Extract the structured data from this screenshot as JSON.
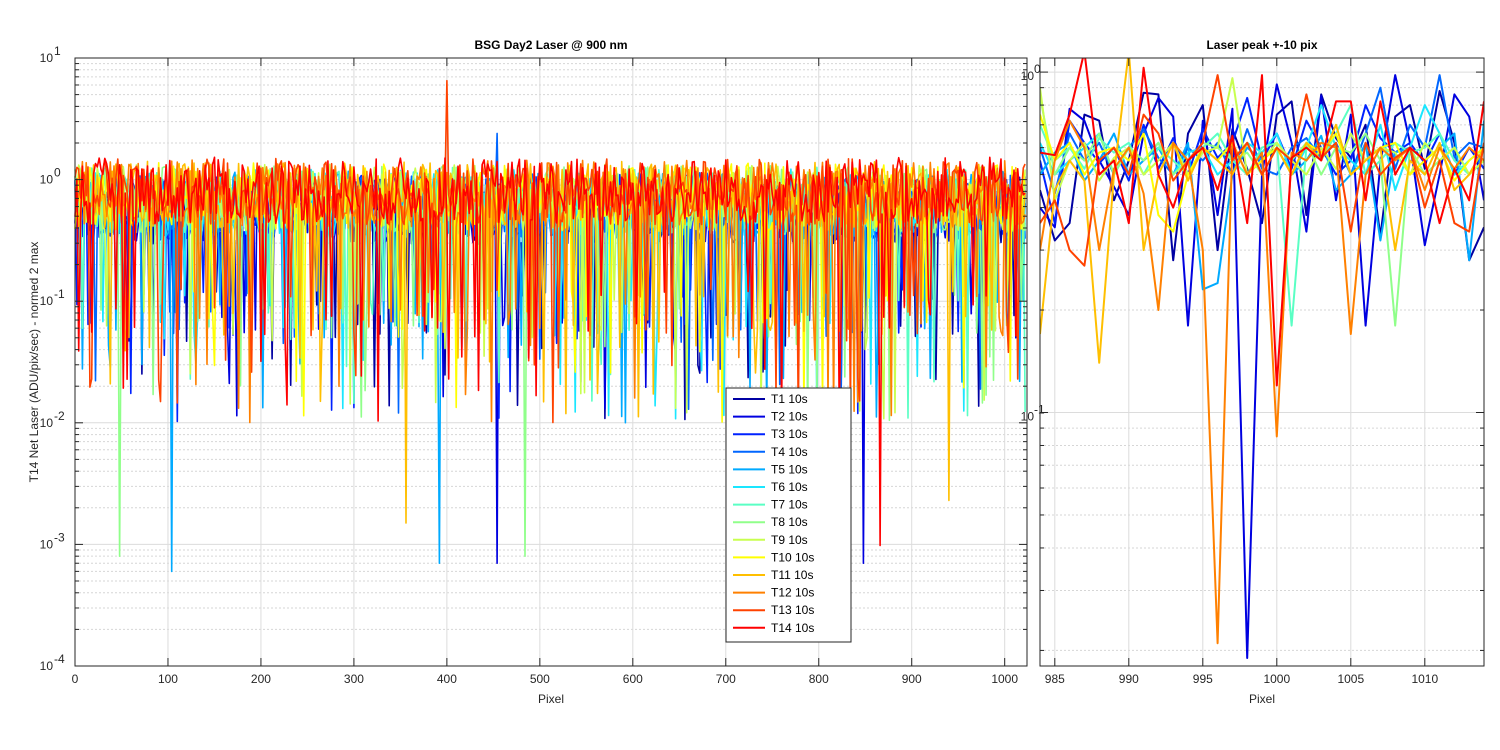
{
  "chart_data": [
    {
      "type": "line",
      "title": "BSG  Day2 Laser @ 900 nm",
      "xlabel": "Pixel",
      "ylabel": "T14 Net Laser (ADU/pix/sec) - normed 2 max",
      "yscale": "log",
      "xlim": [
        0,
        1024
      ],
      "ylim": [
        0.0001,
        10
      ],
      "xticks": [
        "0",
        "100",
        "200",
        "300",
        "400",
        "500",
        "600",
        "700",
        "800",
        "900",
        "1000"
      ],
      "yticks": [
        {
          "base": "10",
          "exp": "-4"
        },
        {
          "base": "10",
          "exp": "-3"
        },
        {
          "base": "10",
          "exp": "-2"
        },
        {
          "base": "10",
          "exp": "-1"
        },
        {
          "base": "10",
          "exp": "0"
        },
        {
          "base": "10",
          "exp": "1"
        }
      ],
      "grid": true,
      "legend_position": "lower-right",
      "series_names": [
        "T1 10s",
        "T2 10s",
        "T3 10s",
        "T4 10s",
        "T5 10s",
        "T6 10s",
        "T7 10s",
        "T8 10s",
        "T9 10s",
        "T10 10s",
        "T11 10s",
        "T12 10s",
        "T13 10s",
        "T14 10s"
      ],
      "series_colors": [
        "#0000a3",
        "#0000e0",
        "#0022ff",
        "#0066ff",
        "#00aaff",
        "#1ae6ff",
        "#5affc4",
        "#90ff8a",
        "#c8ff4f",
        "#ffff00",
        "#ffbf00",
        "#ff8000",
        "#ff4200",
        "#ff0000"
      ],
      "series_summary": "14 normalized laser traces, typical values 0.1-1, occasional dips down to about 6e-4",
      "notable_points": [
        {
          "x": 400,
          "y": 6.5,
          "series": "T13 10s"
        },
        {
          "x": 455,
          "y": 2.4,
          "series": "T4 10s"
        },
        {
          "x": 104,
          "y": 0.0006,
          "series": "T5 10s"
        },
        {
          "x": 454,
          "y": 0.0007,
          "series": "T2 10s"
        },
        {
          "x": 392,
          "y": 0.0007,
          "series": "T5 10s"
        },
        {
          "x": 849,
          "y": 0.0007,
          "series": "T2 10s"
        },
        {
          "x": 866,
          "y": 0.00098,
          "series": "T14 10s"
        },
        {
          "x": 48,
          "y": 0.0008,
          "series": "T8 10s"
        },
        {
          "x": 484,
          "y": 0.0008,
          "series": "T8 10s"
        },
        {
          "x": 357,
          "y": 0.0015,
          "series": "T11 10s"
        },
        {
          "x": 940,
          "y": 0.0023,
          "series": "T11 10s"
        }
      ]
    },
    {
      "type": "line",
      "title": "Laser peak +-10 pix",
      "xlabel": "Pixel",
      "ylabel": "",
      "yscale": "log",
      "xlim": [
        984,
        1014
      ],
      "ylim": [
        0.018,
        1.1
      ],
      "xticks": [
        "985",
        "990",
        "995",
        "1000",
        "1005",
        "1010"
      ],
      "yticks": [
        {
          "base": "10",
          "exp": "-1"
        },
        {
          "base": "10",
          "exp": "0"
        }
      ],
      "grid": true,
      "x": [
        984,
        985,
        986,
        987,
        988,
        989,
        990,
        991,
        992,
        993,
        994,
        995,
        996,
        997,
        998,
        999,
        1000,
        1001,
        1002,
        1003,
        1004,
        1005,
        1006,
        1007,
        1008,
        1009,
        1010,
        1011,
        1012,
        1013,
        1014
      ],
      "series": [
        {
          "name": "T1 10s",
          "values": [
            0.45,
            0.32,
            0.36,
            0.75,
            0.72,
            0.42,
            0.55,
            0.87,
            0.86,
            0.28,
            0.66,
            0.8,
            0.3,
            0.68,
            0.52,
            0.36,
            0.75,
            0.82,
            0.38,
            0.86,
            0.64,
            0.56,
            0.7,
            0.33,
            0.74,
            0.8,
            0.52,
            0.88,
            0.62,
            0.28,
            0.35
          ]
        },
        {
          "name": "T2 10s",
          "values": [
            0.4,
            0.35,
            0.78,
            0.72,
            0.55,
            0.46,
            0.38,
            0.66,
            0.84,
            0.74,
            0.18,
            0.72,
            0.38,
            0.78,
            0.019,
            0.5,
            0.92,
            0.62,
            0.34,
            0.85,
            0.42,
            0.75,
            0.18,
            0.54,
            0.98,
            0.62,
            0.31,
            0.5,
            0.86,
            0.74,
            0.42
          ]
        },
        {
          "name": "T3 10s",
          "values": [
            0.55,
            0.36,
            0.72,
            0.62,
            0.54,
            0.6,
            0.48,
            0.7,
            0.52,
            0.64,
            0.5,
            0.68,
            0.56,
            0.62,
            0.84,
            0.55,
            0.66,
            0.52,
            0.72,
            0.6,
            0.5,
            0.55,
            0.8,
            0.64,
            0.58,
            0.62,
            0.54,
            0.66,
            0.5,
            0.6,
            0.52
          ]
        },
        {
          "name": "T4 10s",
          "values": [
            0.6,
            0.44,
            0.66,
            0.55,
            0.62,
            0.5,
            0.6,
            0.68,
            0.56,
            0.5,
            0.6,
            0.55,
            0.62,
            0.5,
            0.68,
            0.52,
            0.5,
            0.6,
            0.64,
            0.56,
            0.62,
            0.5,
            0.66,
            0.9,
            0.52,
            0.7,
            0.6,
            0.98,
            0.56,
            0.62,
            0.6
          ]
        },
        {
          "name": "T5 10s",
          "values": [
            0.5,
            0.58,
            0.62,
            0.48,
            0.55,
            0.66,
            0.5,
            0.55,
            0.6,
            0.5,
            0.62,
            0.23,
            0.24,
            0.5,
            0.6,
            0.55,
            0.6,
            0.5,
            0.55,
            0.65,
            0.45,
            0.5,
            0.62,
            0.32,
            0.58,
            0.6,
            0.55,
            0.6,
            0.66,
            0.28,
            0.72
          ]
        },
        {
          "name": "T6 10s",
          "values": [
            0.62,
            0.5,
            0.55,
            0.6,
            0.66,
            0.5,
            0.6,
            0.55,
            0.62,
            0.5,
            0.58,
            0.6,
            0.5,
            0.55,
            0.62,
            0.58,
            0.66,
            0.5,
            0.6,
            0.8,
            0.6,
            0.55,
            0.5,
            0.7,
            0.45,
            0.6,
            0.8,
            0.66,
            0.5,
            0.55,
            0.6
          ]
        },
        {
          "name": "T7 10s",
          "values": [
            0.7,
            0.55,
            0.6,
            0.52,
            0.64,
            0.58,
            0.62,
            0.5,
            0.6,
            0.55,
            0.5,
            0.6,
            0.66,
            0.55,
            0.5,
            0.6,
            0.62,
            0.18,
            0.6,
            0.55,
            0.66,
            0.8,
            0.5,
            0.55,
            0.62,
            0.58,
            0.6,
            0.66,
            0.55,
            0.5,
            0.6
          ]
        },
        {
          "name": "T8 10s",
          "values": [
            0.85,
            0.5,
            0.6,
            0.55,
            0.66,
            0.5,
            0.6,
            0.55,
            0.62,
            0.5,
            0.55,
            0.62,
            0.6,
            0.55,
            0.58,
            0.5,
            0.6,
            0.55,
            0.62,
            0.5,
            0.6,
            0.58,
            0.66,
            0.55,
            0.18,
            0.6,
            0.5,
            0.55,
            0.6,
            0.5,
            0.55
          ]
        },
        {
          "name": "T9 10s",
          "values": [
            0.9,
            0.42,
            0.55,
            0.62,
            0.48,
            0.56,
            0.6,
            0.5,
            0.55,
            0.62,
            0.5,
            0.58,
            0.6,
            0.96,
            0.5,
            0.55,
            0.62,
            0.55,
            0.5,
            0.6,
            0.52,
            0.66,
            0.55,
            0.6,
            0.58,
            0.5,
            0.62,
            0.55,
            0.6,
            0.5,
            0.55
          ]
        },
        {
          "name": "T10 10s",
          "values": [
            0.75,
            0.55,
            0.62,
            0.5,
            0.58,
            0.6,
            0.55,
            0.66,
            0.38,
            0.34,
            0.5,
            0.6,
            0.55,
            0.62,
            0.5,
            0.55,
            0.6,
            0.5,
            0.62,
            0.58,
            0.66,
            0.5,
            0.55,
            0.6,
            0.62,
            0.5,
            0.55,
            0.6,
            0.48,
            0.55,
            0.6
          ]
        },
        {
          "name": "T11 10s",
          "values": [
            0.17,
            0.45,
            0.55,
            0.48,
            0.14,
            0.5,
            1.15,
            0.3,
            0.5,
            0.62,
            0.48,
            0.6,
            0.55,
            0.5,
            0.62,
            0.5,
            0.6,
            0.5,
            0.62,
            0.55,
            0.7,
            0.5,
            0.55,
            0.6,
            0.3,
            0.55,
            0.5,
            0.62,
            0.45,
            0.5,
            0.6
          ]
        },
        {
          "name": "T12 10s",
          "values": [
            0.3,
            0.55,
            0.72,
            0.6,
            0.3,
            0.52,
            0.6,
            0.44,
            0.2,
            0.62,
            0.55,
            0.3,
            0.021,
            0.62,
            0.5,
            0.58,
            0.085,
            0.58,
            0.55,
            0.62,
            0.6,
            0.17,
            0.5,
            0.6,
            0.55,
            0.6,
            0.45,
            0.6,
            0.52,
            0.6,
            0.55
          ]
        },
        {
          "name": "T13 10s",
          "values": [
            0.36,
            0.42,
            0.3,
            0.27,
            0.55,
            0.6,
            0.5,
            0.75,
            0.66,
            0.48,
            0.55,
            0.62,
            0.98,
            0.55,
            0.62,
            0.5,
            0.6,
            0.55,
            0.86,
            0.56,
            0.62,
            0.34,
            0.62,
            0.5,
            0.56,
            0.6,
            0.4,
            0.55,
            0.36,
            0.34,
            0.62
          ]
        },
        {
          "name": "T14 10s",
          "values": [
            0.58,
            0.57,
            0.75,
            1.15,
            0.5,
            0.55,
            0.36,
            1.03,
            0.5,
            0.4,
            0.55,
            0.6,
            0.45,
            0.65,
            0.36,
            0.98,
            0.12,
            0.56,
            0.6,
            0.55,
            0.82,
            0.82,
            0.42,
            0.82,
            0.5,
            0.6,
            0.55,
            0.36,
            0.52,
            0.42,
            0.82
          ]
        }
      ]
    }
  ]
}
